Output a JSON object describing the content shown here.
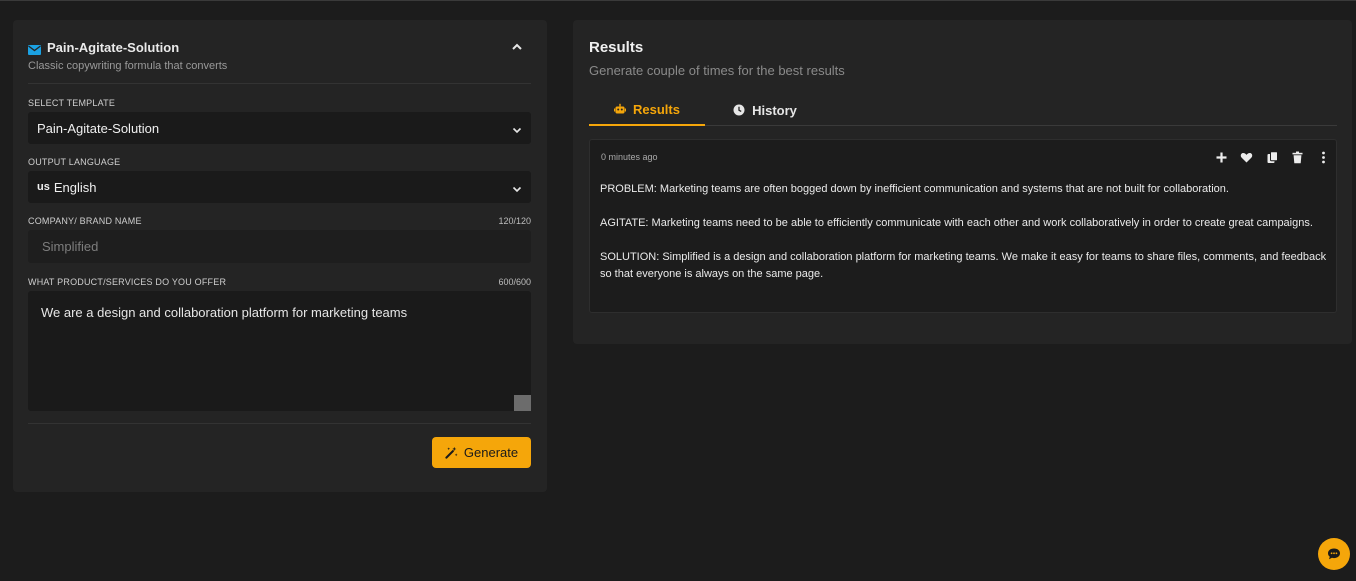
{
  "form": {
    "title": "Pain-Agitate-Solution",
    "subtitle": "Classic copywriting formula that converts",
    "template_label": "SELECT TEMPLATE",
    "template_value": "Pain-Agitate-Solution",
    "language_label": "OUTPUT LANGUAGE",
    "language_flag": "us",
    "language_value": "English",
    "brand_label": "COMPANY/ BRAND NAME",
    "brand_counter": "120/120",
    "brand_placeholder": "Simplified",
    "product_label": "WHAT PRODUCT/SERVICES DO YOU OFFER",
    "product_counter": "600/600",
    "product_value": "We are a design and collaboration platform for marketing teams",
    "generate_label": "Generate"
  },
  "results": {
    "title": "Results",
    "subtitle": "Generate couple of times for the best results",
    "tabs": [
      {
        "label": "Results",
        "icon": "robot-icon",
        "active": true
      },
      {
        "label": "History",
        "icon": "clock-icon",
        "active": false
      }
    ],
    "card": {
      "timestamp": "0 minutes ago",
      "actions": [
        "plus-icon",
        "heart-icon",
        "copy-icon",
        "trash-icon",
        "more-vertical-icon"
      ],
      "paragraphs": [
        "PROBLEM: Marketing teams are often bogged down by inefficient communication and systems that are not built for collaboration.",
        "AGITATE: Marketing teams need to be able to efficiently communicate with each other and work collaboratively in order to create great campaigns.",
        "SOLUTION: Simplified is a design and collaboration platform for marketing teams. We make it easy for teams to share files, comments, and feedback so that everyone is always on the same page."
      ]
    }
  },
  "colors": {
    "accent": "#f5a60a",
    "mail_icon": "#1ba1e2",
    "background": "#1c1c1c",
    "panel": "#242424"
  }
}
